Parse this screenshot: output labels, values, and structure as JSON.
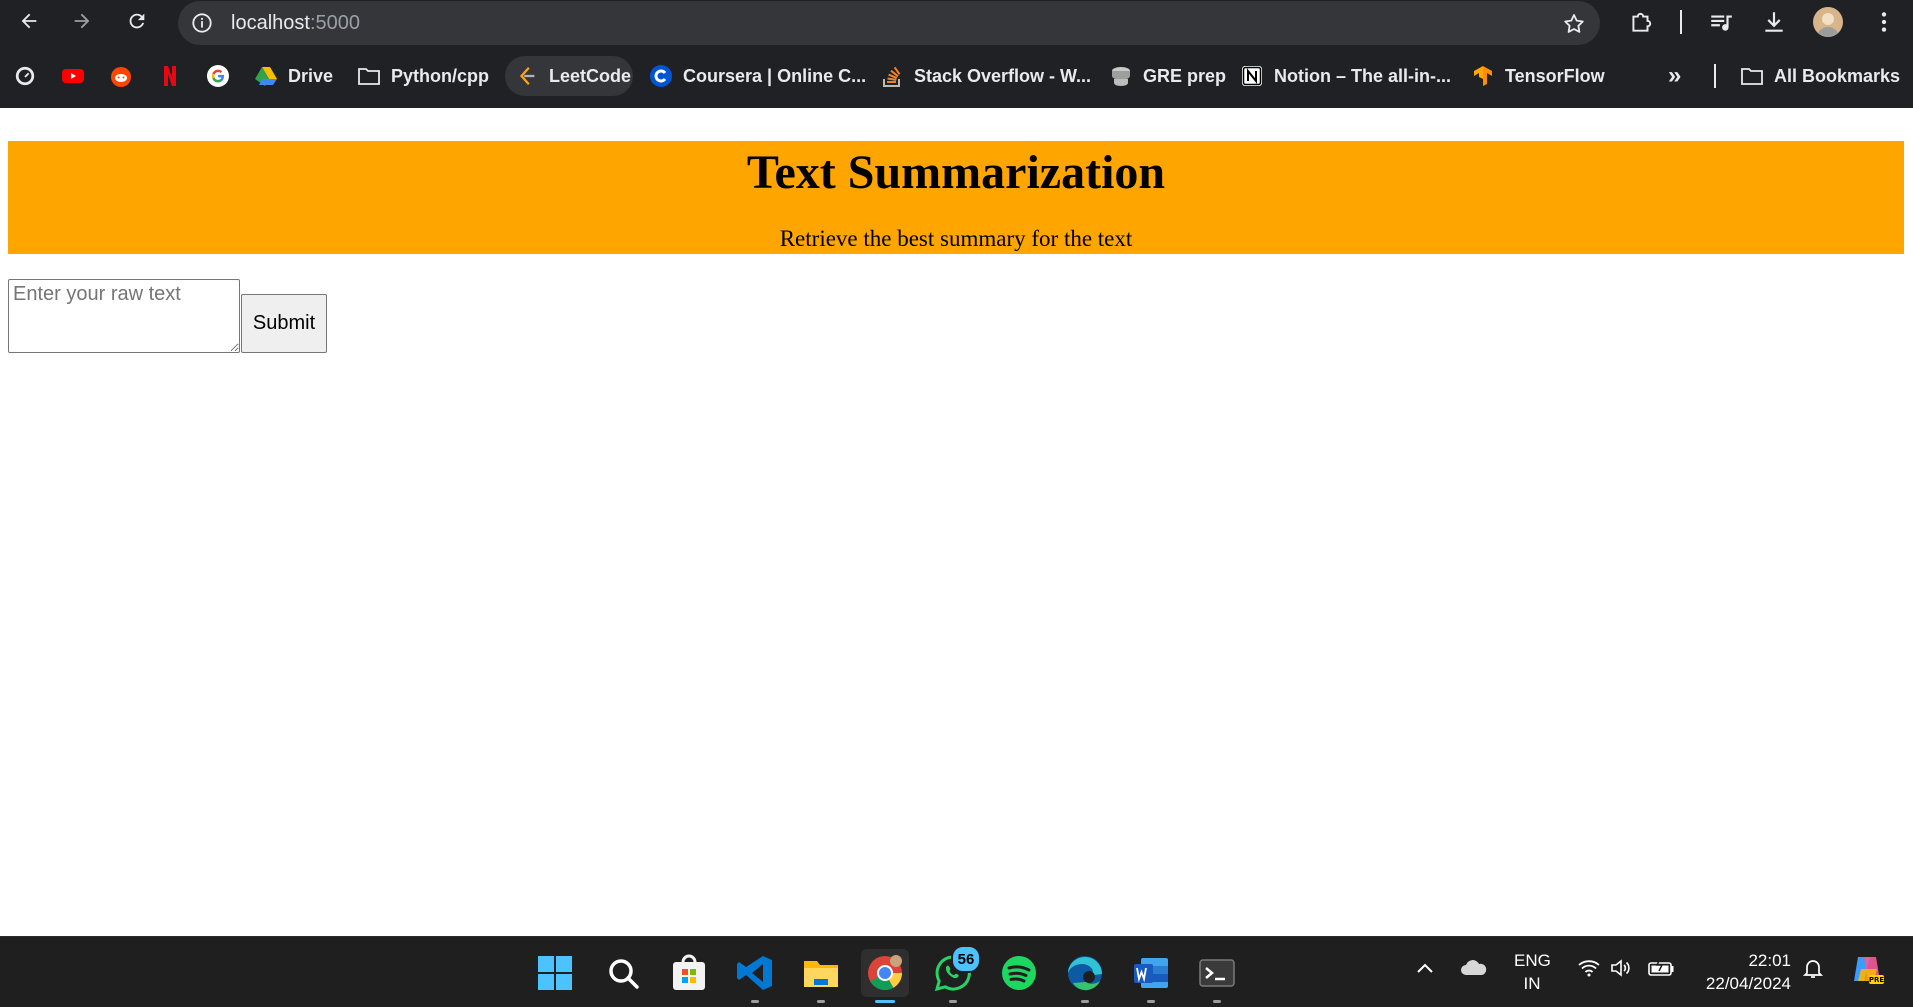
{
  "browser": {
    "url_host": "localhost",
    "url_port": ":5000",
    "bookmarks": [
      {
        "label": ""
      },
      {
        "label": ""
      },
      {
        "label": ""
      },
      {
        "label": ""
      },
      {
        "label": ""
      },
      {
        "label": "Drive"
      },
      {
        "label": "Python/cpp"
      },
      {
        "label": "LeetCode"
      },
      {
        "label": "Coursera | Online C..."
      },
      {
        "label": "Stack Overflow - W..."
      },
      {
        "label": "GRE prep"
      },
      {
        "label": "Notion – The all-in-..."
      },
      {
        "label": "TensorFlow"
      }
    ],
    "overflow_label": "»",
    "all_bookmarks_label": "All Bookmarks"
  },
  "page": {
    "title": "Text Summarization",
    "subtitle": "Retrieve the best summary for the text",
    "textarea_placeholder": "Enter your raw text",
    "submit_label": "Submit",
    "header_color": "#ffa500"
  },
  "taskbar": {
    "apps": [
      "start",
      "search",
      "microsoft-store",
      "vscode",
      "file-explorer",
      "chrome",
      "whatsapp",
      "spotify",
      "edge",
      "word",
      "terminal"
    ],
    "whatsapp_badge": "56",
    "language_line1": "ENG",
    "language_line2": "IN",
    "time": "22:01",
    "date": "22/04/2024"
  }
}
